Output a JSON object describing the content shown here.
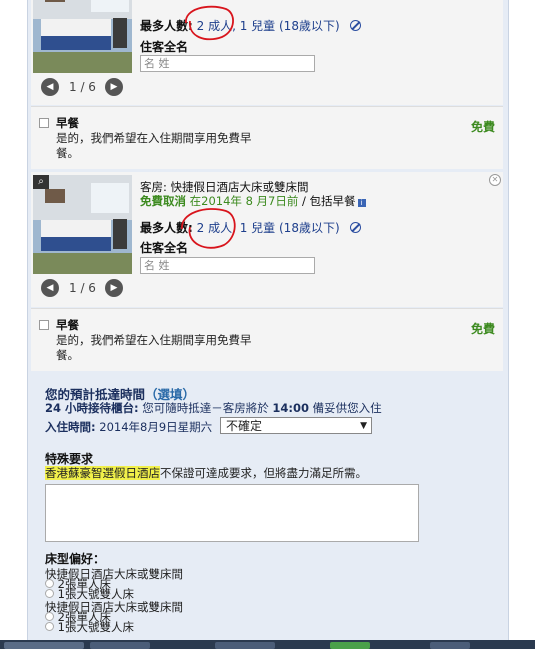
{
  "rooms": [
    {
      "title": "",
      "cancel": "",
      "cancel_date": "",
      "breakfast_incl": "",
      "max_label": "最多人數:",
      "max_adults": "2 成人",
      "max_children": ", 1 兒童",
      "max_child_age": " (18歲以下)",
      "guest_label": "住客全名",
      "name_placeholder": "名 姓",
      "pager": "1 / 6",
      "breakfast_title": "早餐",
      "breakfast_desc": "是的，我們希望在入住期間享用免費早餐。",
      "breakfast_price": "免費"
    },
    {
      "title": "客房: 快捷假日酒店大床或雙床間",
      "cancel": "免費取消",
      "cancel_date": " 在2014年 8 月7日前",
      "breakfast_incl": " / 包括早餐",
      "max_label": "最多人數:",
      "max_adults": "2 成人",
      "max_children": ", 1 兒童",
      "max_child_age": " (18歲以下)",
      "guest_label": "住客全名",
      "name_placeholder": "名 姓",
      "pager": "1 / 6",
      "breakfast_title": "早餐",
      "breakfast_desc": "是的，我們希望在入住期間享用免費早餐。",
      "breakfast_price": "免費"
    }
  ],
  "arrival": {
    "heading": "您的預計抵達時間",
    "optional": "（選填）",
    "desk_bold": "24 小時接待櫃台:",
    "desk_text": " 您可隨時抵達－客房將於 ",
    "desk_time": "14:00",
    "desk_tail": " 備妥供您入住",
    "checkin_label": "入住時間:",
    "checkin_date": " 2014年8月9日星期六",
    "select_value": "不確定"
  },
  "special": {
    "heading": "特殊要求",
    "hotel": "香港蘇豪智選假日酒店",
    "note": "不保證可達成要求，但將盡力滿足所需。"
  },
  "bed": {
    "heading": "床型偏好：",
    "rooms": [
      {
        "room": "快捷假日酒店大床或雙床間",
        "opt1": "2張單人床",
        "opt2": "1張大號雙人床"
      },
      {
        "room": "快捷假日酒店大床或雙床間",
        "opt1": "2張單人床",
        "opt2": "1張大號雙人床"
      }
    ]
  },
  "colors": {
    "green": "#3c8a1f",
    "highlight": "#f1f04a",
    "circle": "#d8141c"
  }
}
